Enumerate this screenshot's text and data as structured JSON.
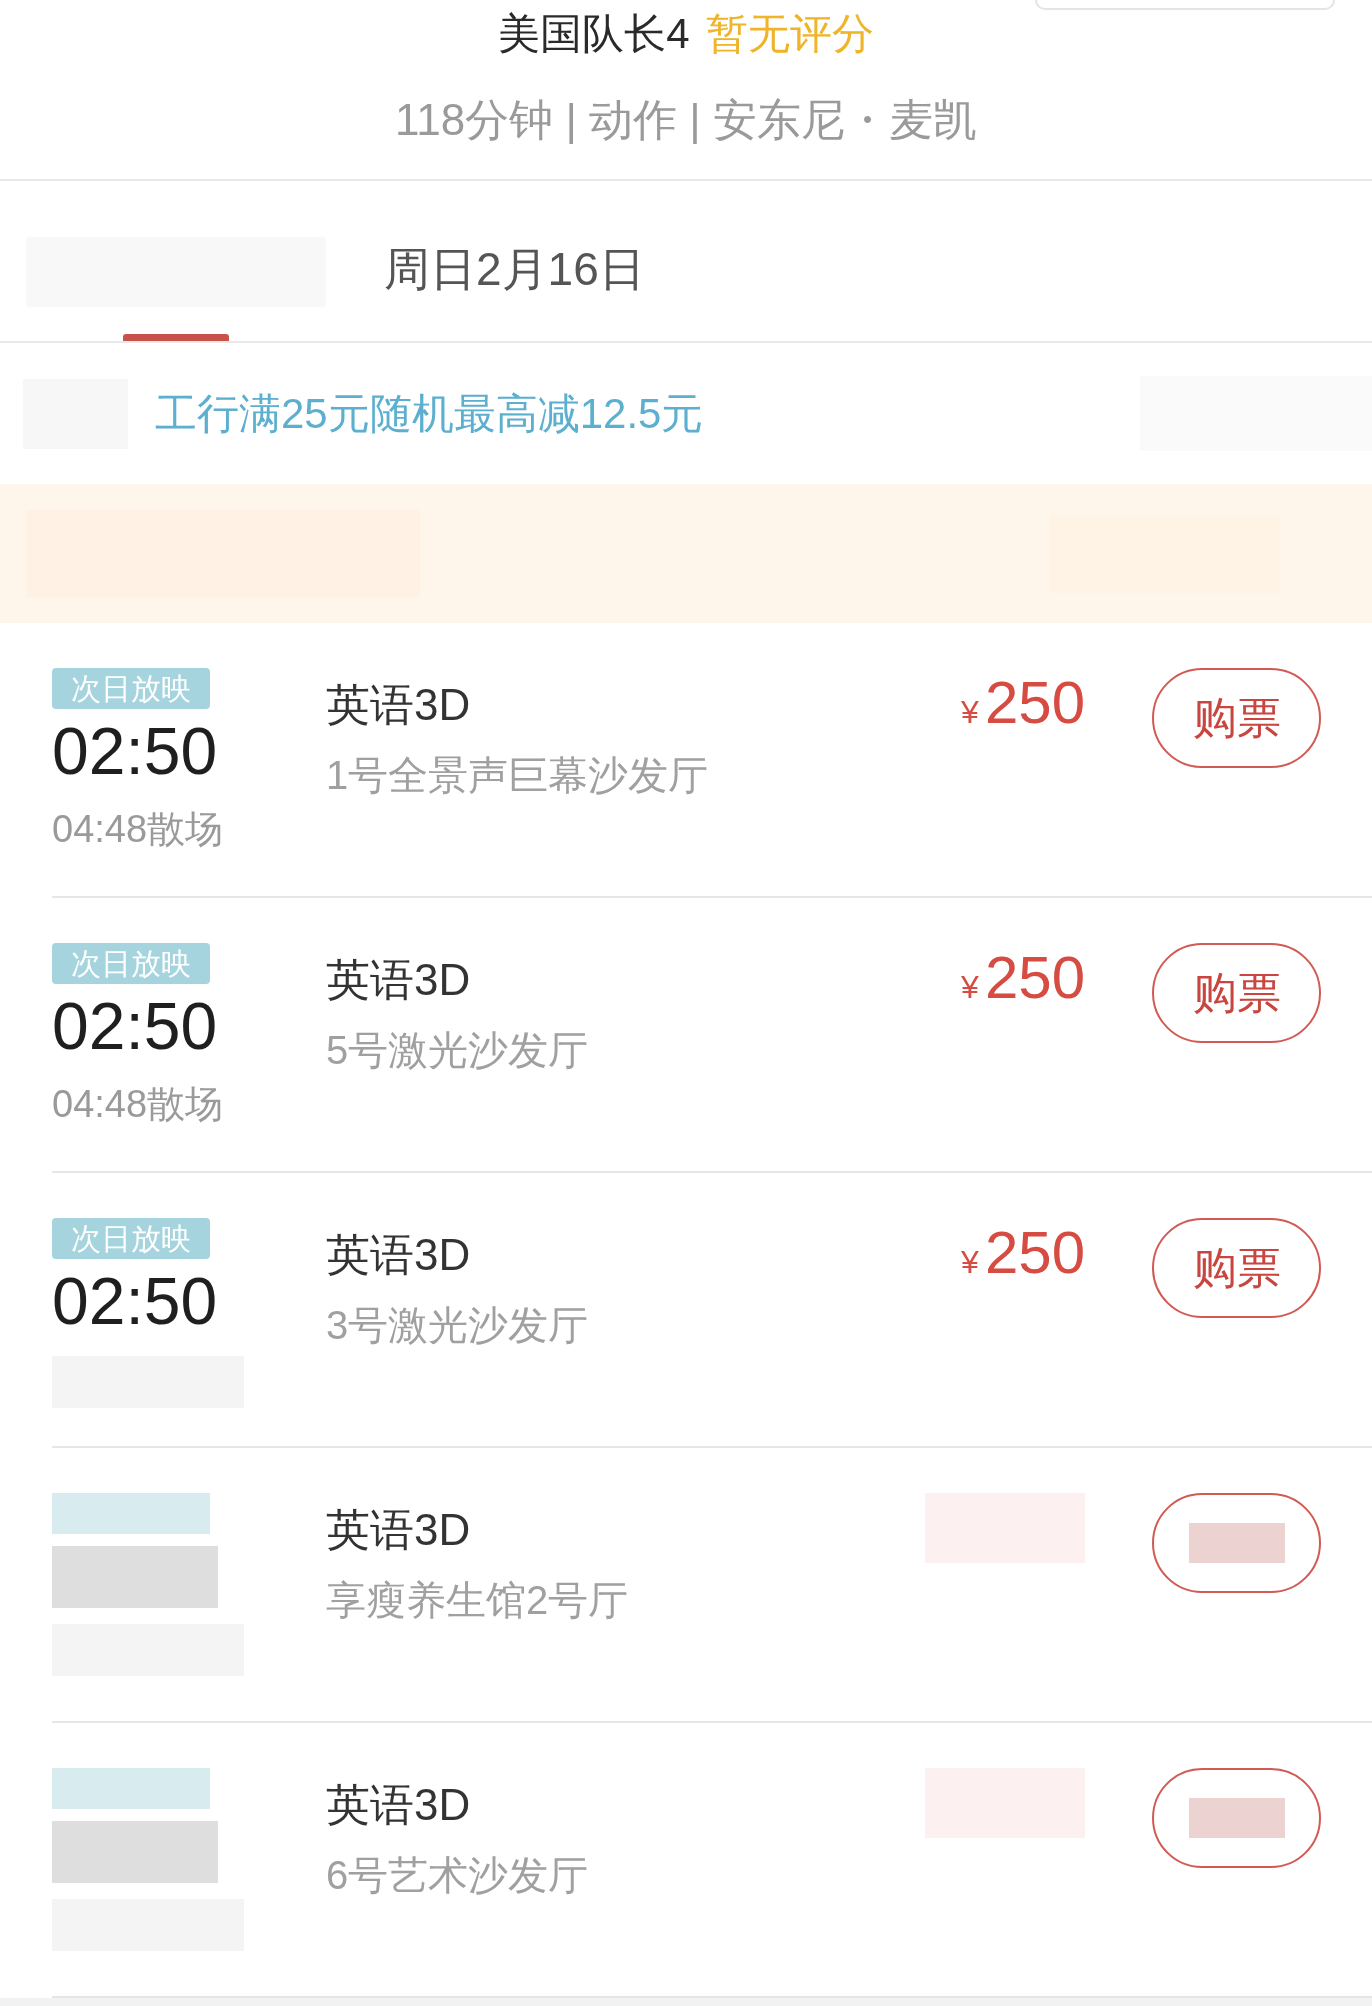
{
  "header": {
    "title": "美国队长4",
    "rating": "暂无评分",
    "info": "118分钟 | 动作 | 安东尼・麦凯",
    "corner_button_visible": true
  },
  "date_tabs": [
    {
      "blurred": true,
      "selected": true
    },
    {
      "label": "周日2月16日",
      "selected": false
    }
  ],
  "promo": {
    "icon_blurred": true,
    "text": "工行满25元随机最高减12.5元",
    "side_blurred": true
  },
  "offer_banner": {
    "blurred": true
  },
  "showtimes": [
    {
      "tag": "次日放映",
      "start": "02:50",
      "end": "04:48散场",
      "language": "英语3D",
      "hall": "1号全景声巨幕沙发厅",
      "currency": "¥",
      "price": "250",
      "button": "购票"
    },
    {
      "tag": "次日放映",
      "start": "02:50",
      "end": "04:48散场",
      "language": "英语3D",
      "hall": "5号激光沙发厅",
      "currency": "¥",
      "price": "250",
      "button": "购票"
    },
    {
      "tag": "次日放映",
      "start": "02:50",
      "language": "英语3D",
      "hall": "3号激光沙发厅",
      "currency": "¥",
      "price": "250",
      "button": "购票"
    },
    {
      "language": "英语3D",
      "hall": "享瘦养生馆2号厅"
    },
    {
      "language": "英语3D",
      "hall": "6号艺术沙发厅"
    }
  ]
}
